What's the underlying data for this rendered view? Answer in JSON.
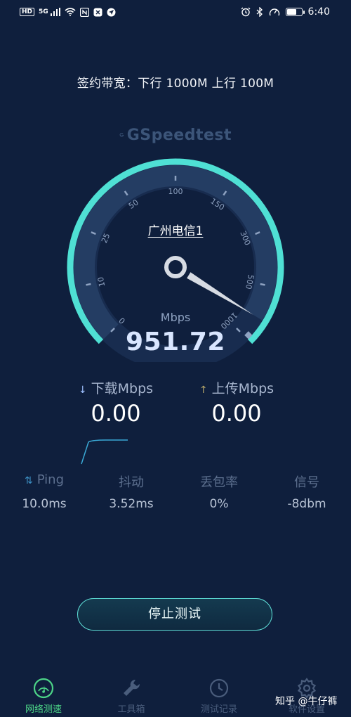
{
  "status_bar": {
    "left_icons": [
      "HD",
      "5G",
      "signal-icon",
      "wifi-icon",
      "nfc-icon",
      "vpn-icon",
      "location-icon"
    ],
    "hd_label": "HD",
    "network_label": "5G",
    "time": "6:40",
    "battery_level": 0.7
  },
  "bandwidth_text": "签约带宽：下行 1000M  上行 100M",
  "logo_text": "GSpeedtest",
  "gauge": {
    "ticks": [
      "0",
      "10",
      "25",
      "50",
      "100",
      "150",
      "300",
      "500",
      "1000"
    ],
    "server": "广州电信1",
    "unit": "Mbps",
    "value": "951.72",
    "needle_fraction": 0.95,
    "accent_color": "#4fe0d4"
  },
  "download": {
    "label": "下载Mbps",
    "value": "0.00"
  },
  "upload": {
    "label": "上传Mbps",
    "value": "0.00"
  },
  "stats": {
    "ping": {
      "label": "Ping",
      "value": "10.0ms"
    },
    "jitter": {
      "label": "抖动",
      "value": "3.52ms"
    },
    "loss": {
      "label": "丢包率",
      "value": "0%"
    },
    "signal": {
      "label": "信号",
      "value": "-8dbm"
    }
  },
  "stop_button": "停止测试",
  "nav": [
    {
      "label": "网络测速",
      "icon": "speedometer-icon",
      "active": true
    },
    {
      "label": "工具箱",
      "icon": "wrench-icon",
      "active": false
    },
    {
      "label": "测试记录",
      "icon": "clock-icon",
      "active": false
    },
    {
      "label": "软件设置",
      "icon": "gear-icon",
      "active": false
    }
  ],
  "watermark": "知乎 @牛仔裤"
}
